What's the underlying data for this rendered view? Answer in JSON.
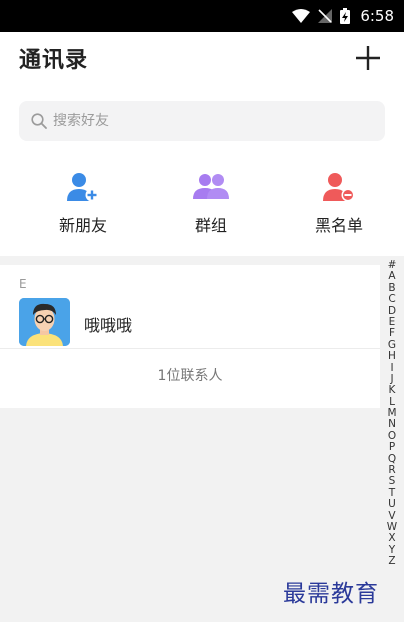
{
  "status_bar": {
    "time": "6:58"
  },
  "header": {
    "title": "通讯录"
  },
  "search": {
    "placeholder": "搜索好友"
  },
  "quick_actions": [
    {
      "label": "新朋友",
      "icon": "add-user-icon",
      "color": "#3b8be6"
    },
    {
      "label": "群组",
      "icon": "group-icon",
      "color": "#a77cf0"
    },
    {
      "label": "黑名单",
      "icon": "block-user-icon",
      "color": "#ef5a5a"
    }
  ],
  "contacts": {
    "section_letter": "E",
    "items": [
      {
        "name": "哦哦哦"
      }
    ],
    "count_text": "1位联系人"
  },
  "index_letters": [
    "#",
    "A",
    "B",
    "C",
    "D",
    "E",
    "F",
    "G",
    "H",
    "I",
    "J",
    "K",
    "L",
    "M",
    "N",
    "O",
    "P",
    "Q",
    "R",
    "S",
    "T",
    "U",
    "V",
    "W",
    "X",
    "Y",
    "Z"
  ],
  "watermark": "最需教育"
}
